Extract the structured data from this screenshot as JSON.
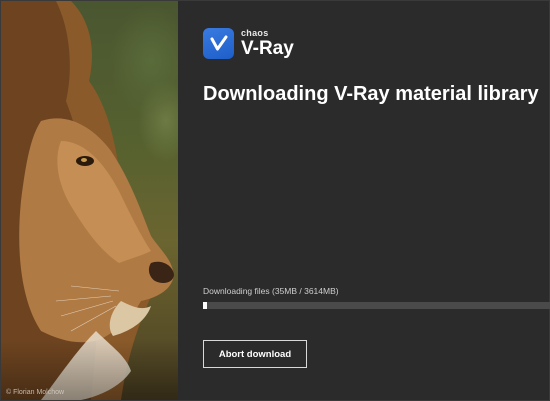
{
  "photo": {
    "credit": "© Florian Molchow",
    "icon": "lion-photo"
  },
  "logo": {
    "icon": "vray-check-icon",
    "brand": "chaos",
    "product": "V-Ray",
    "accent": "#2a6fd8"
  },
  "title": "Downloading V-Ray material library",
  "download": {
    "status": "Downloading files (35MB / 3614MB)",
    "downloaded_mb": 35,
    "total_mb": 3614,
    "progress_fraction": 0.0097
  },
  "actions": {
    "abort_label": "Abort download"
  }
}
